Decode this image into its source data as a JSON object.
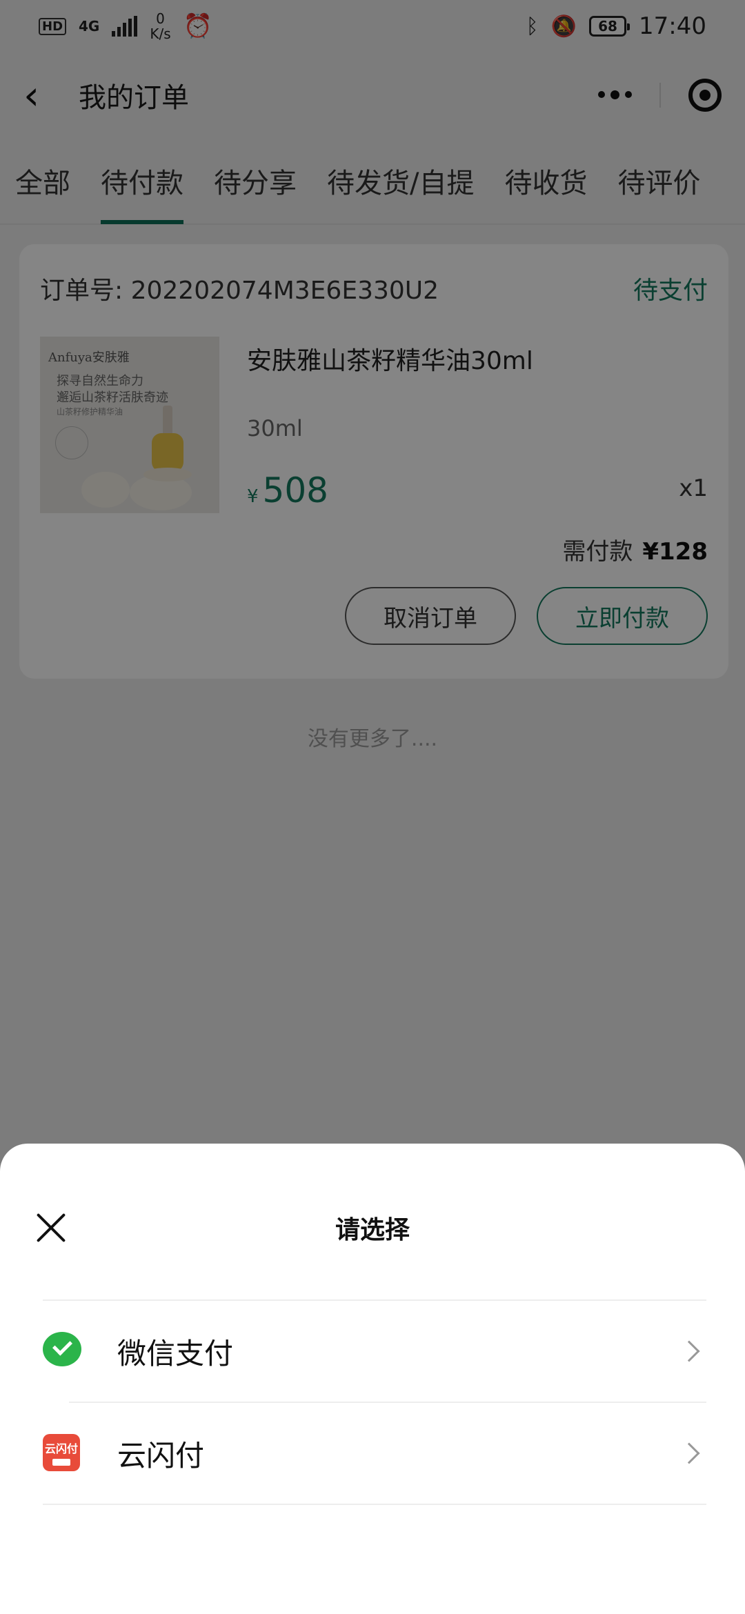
{
  "status_bar": {
    "hd": "HD",
    "network": "4G",
    "net_speed_value": "0",
    "net_speed_unit": "K/s",
    "battery": "68",
    "time": "17:40"
  },
  "nav": {
    "title": "我的订单"
  },
  "tabs": [
    {
      "label": "全部",
      "active": false
    },
    {
      "label": "待付款",
      "active": true
    },
    {
      "label": "待分享",
      "active": false
    },
    {
      "label": "待发货/自提",
      "active": false
    },
    {
      "label": "待收货",
      "active": false
    },
    {
      "label": "待评价",
      "active": false
    }
  ],
  "order": {
    "order_no_label": "订单号: 202202074M3E6E330U2",
    "status": "待支付",
    "product": {
      "image_brand": "Anfuya安肤雅",
      "image_line1": "探寻自然生命力",
      "image_line2": "邂逅山茶籽活肤奇迹",
      "image_line3": "山茶籽修护精华油",
      "name": "安肤雅山茶籽精华油30ml",
      "spec": "30ml",
      "currency": "¥",
      "price": "508",
      "qty": "x1"
    },
    "need_pay_label": "需付款",
    "need_pay_amount": "¥128",
    "cancel_label": "取消订单",
    "pay_label": "立即付款"
  },
  "no_more": "没有更多了....",
  "sheet": {
    "title": "请选择",
    "options": [
      {
        "label": "微信支付",
        "icon": "wechat-pay-icon"
      },
      {
        "label": "云闪付",
        "icon": "unionpay-quickpass-icon",
        "icon_text": "云闪付"
      }
    ]
  },
  "colors": {
    "accent": "#14795e",
    "wechat": "#2bb44a",
    "unionpay": "#e84b3a"
  }
}
